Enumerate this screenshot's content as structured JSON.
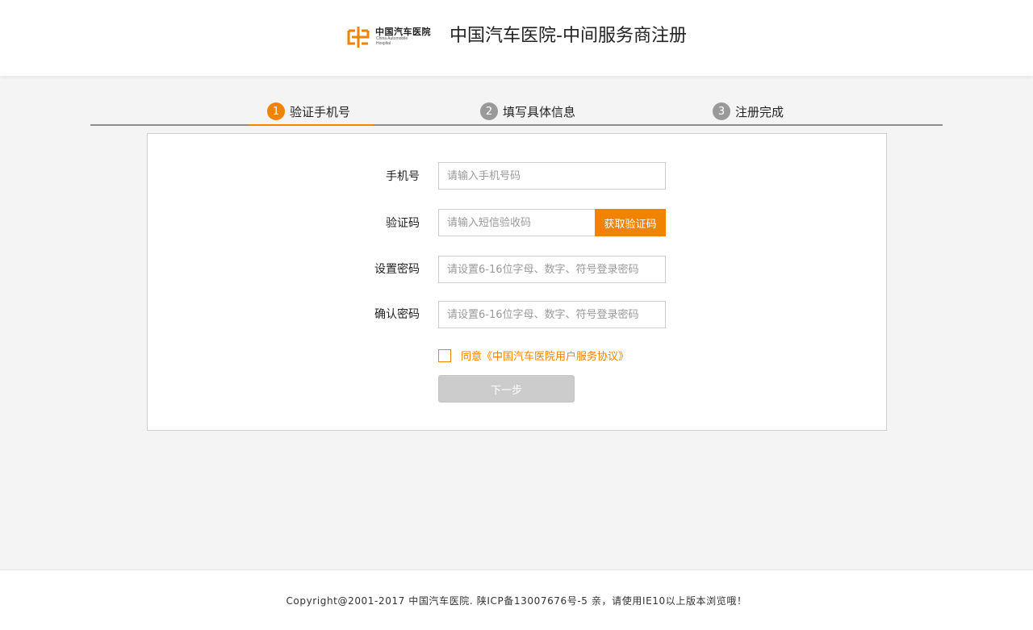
{
  "header": {
    "logo": {
      "cn": "中国汽车医院",
      "en": "China Automobile\nHospital",
      "mark_icon": "logo-mark-icon"
    },
    "title": "中国汽车医院-中间服务商注册"
  },
  "steps": [
    {
      "num": "1",
      "label": "验证手机号",
      "active": true
    },
    {
      "num": "2",
      "label": "填写具体信息",
      "active": false
    },
    {
      "num": "3",
      "label": "注册完成",
      "active": false
    }
  ],
  "form": {
    "phone": {
      "label": "手机号",
      "placeholder": "请输入手机号码",
      "value": ""
    },
    "code": {
      "label": "验证码",
      "placeholder": "请输入短信验收码",
      "value": "",
      "button": "获取验证码"
    },
    "password": {
      "label": "设置密码",
      "placeholder": "请设置6-16位字母、数字、符号登录密码",
      "value": ""
    },
    "confirm": {
      "label": "确认密码",
      "placeholder": "请设置6-16位字母、数字、符号登录密码",
      "value": ""
    },
    "agreement": {
      "text": "同意《中国汽车医院用户服务协议》",
      "checked": false
    },
    "next_button": "下一步"
  },
  "footer": {
    "text": "Copyright@2001-2017 中国汽车医院. 陕ICP备13007676号-5   亲，请使用IE10以上版本浏览哦！"
  },
  "colors": {
    "accent": "#f08300",
    "step_inactive": "#999999",
    "disabled_button": "#cccccc"
  }
}
